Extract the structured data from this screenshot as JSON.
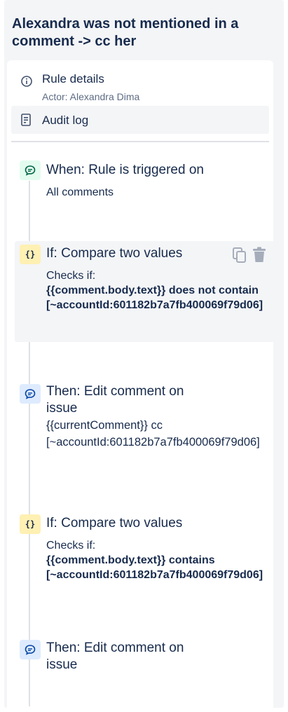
{
  "title": "Alexandra was not mentioned in a comment -> cc her",
  "rule_details": {
    "label": "Rule details",
    "actor": "Actor: Alexandra Dima",
    "icon": "info-icon"
  },
  "audit_log": {
    "label": "Audit log",
    "icon": "document-icon"
  },
  "steps": [
    {
      "type": "trigger",
      "icon": "comment-icon",
      "color": "#e3fcef",
      "heading": "When: Rule is triggered on",
      "description": "All comments"
    },
    {
      "type": "condition",
      "icon": "braces-icon",
      "badge_text": "{}",
      "color": "#fff0b3",
      "heading": "If: Compare two values",
      "checks_label": "Checks if:",
      "expression": "{{comment.body.text}} does not contain [~accountId:601182b7a7fb400069f79d06]"
    },
    {
      "type": "action",
      "icon": "comment-icon",
      "color": "#deebff",
      "heading_line1": "Then: Edit comment on",
      "heading_line2": "issue",
      "description": "{{currentComment}} cc [~accountId:601182b7a7fb400069f79d06]"
    },
    {
      "type": "condition",
      "icon": "braces-icon",
      "badge_text": "{}",
      "color": "#fff0b3",
      "heading": "If: Compare two values",
      "checks_label": "Checks if:",
      "expression": "{{comment.body.text}} contains [~accountId:601182b7a7fb400069f79d06]"
    },
    {
      "type": "action",
      "icon": "comment-icon",
      "color": "#deebff",
      "heading_line1": "Then: Edit comment on",
      "heading_line2": "issue"
    }
  ],
  "tools": {
    "copy_icon": "copy-icon",
    "delete_icon": "trash-icon"
  }
}
